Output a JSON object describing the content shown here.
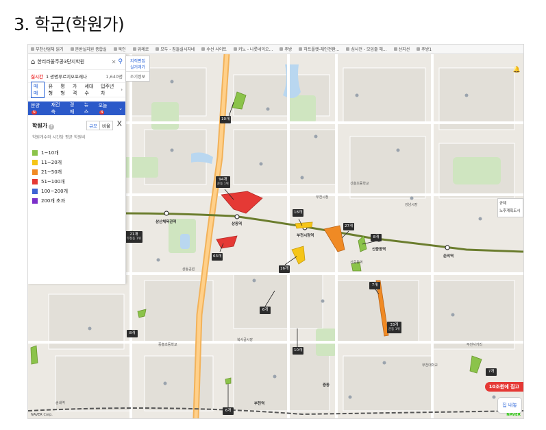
{
  "slide": {
    "title": "3. 학군(학원가)"
  },
  "bookmarks": [
    "부천산업체 읽기",
    "본받실지원 종합실",
    "북인",
    "위례로",
    "모두 - 집들실시자네",
    "수선 사이트",
    "키노 - 나롯네익오...",
    "주방",
    "하트플랫-래인전환...",
    "심사전 - 모임줄 해...",
    "선지선",
    "주방1"
  ],
  "panel": {
    "search_text": "한리라울주공3단지학원",
    "realtime_label": "실시간",
    "realtime_item": "1 광명푸르지오포레나",
    "realtime_count": "1,640명",
    "tabs": [
      "매매",
      "유형",
      "평형",
      "가격",
      "세대수",
      "입주년차"
    ],
    "tabs2": [
      "분양",
      "재건축",
      "경매",
      "뉴스",
      "오늘"
    ],
    "academy_title": "학원가",
    "seg_on": "규모",
    "seg_off": "비율",
    "close": "X",
    "academy_sub": "학원개수와 시간당 평균 학원비",
    "legend": [
      {
        "label": "1~10개",
        "color": "#8bc34a"
      },
      {
        "label": "11~20개",
        "color": "#f5c518"
      },
      {
        "label": "21~50개",
        "color": "#f08a24"
      },
      {
        "label": "51~100개",
        "color": "#e53935"
      },
      {
        "label": "100~200개",
        "color": "#3f63d4"
      },
      {
        "label": "200개 초과",
        "color": "#7b2fc9"
      }
    ]
  },
  "float_button": {
    "label": "지적편집",
    "sub": "실거래가",
    "sub2": "조기정보"
  },
  "right_popup": [
    "규제",
    "노후계획도시"
  ],
  "ad_label": "10조원에 집고",
  "house_button": "집 내놓",
  "footer_left": "NAVER Corp.",
  "footer_right": "NAVER",
  "clusters": [
    {
      "count": "10개"
    },
    {
      "count": "94개",
      "sub": "운동 1위"
    },
    {
      "count": "18개"
    },
    {
      "count": "27개"
    },
    {
      "count": "8개"
    },
    {
      "count": "21개",
      "sub": "부천동 1위"
    },
    {
      "count": "63개"
    },
    {
      "count": "16개"
    },
    {
      "count": "7개"
    },
    {
      "count": "6개"
    },
    {
      "count": "33개",
      "sub": "운동 1위"
    },
    {
      "count": "8개"
    },
    {
      "count": "10개"
    },
    {
      "count": "6개"
    },
    {
      "count": "7개"
    }
  ],
  "stations": [
    "상동역",
    "삼산체육관역",
    "신중동역",
    "부천시청역",
    "춘의역",
    "중동",
    "부천역"
  ],
  "places": [
    "신중동역",
    "강남시장",
    "부천시청",
    "상동공원",
    "부천사거리",
    "송내역",
    "복사골시장",
    "부천대학교",
    "신흥초등학교",
    "중흥초등학교"
  ]
}
